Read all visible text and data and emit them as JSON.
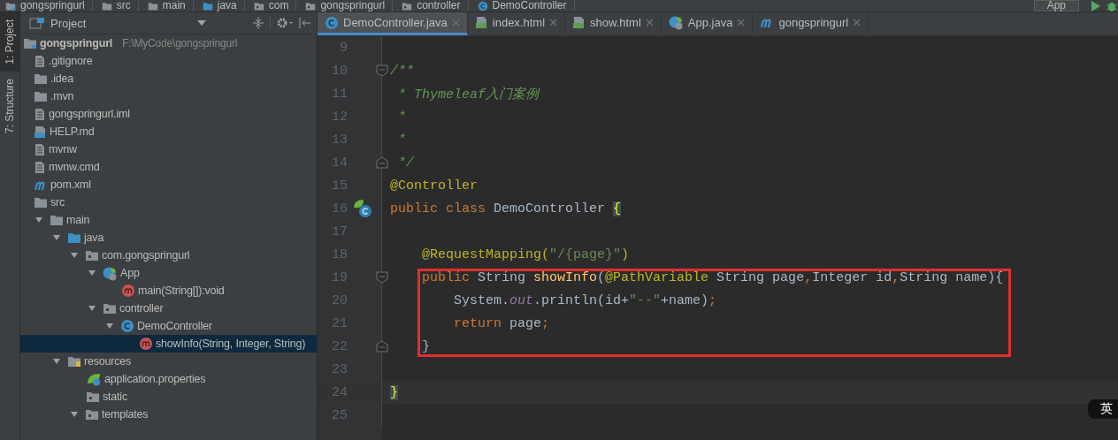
{
  "breadcrumbs": [
    {
      "label": "gongspringurl",
      "kind": "module"
    },
    {
      "label": "src",
      "kind": "folder"
    },
    {
      "label": "main",
      "kind": "folder"
    },
    {
      "label": "java",
      "kind": "java-folder"
    },
    {
      "label": "com",
      "kind": "package"
    },
    {
      "label": "gongspringurl",
      "kind": "package"
    },
    {
      "label": "controller",
      "kind": "package"
    },
    {
      "label": "DemoController",
      "kind": "class"
    }
  ],
  "run_config": {
    "label": "App"
  },
  "tool_strip": [
    {
      "label": "1: Project",
      "selected": true
    },
    {
      "label": "7: Structure",
      "selected": false
    }
  ],
  "project_panel": {
    "title": "Project",
    "tree": [
      {
        "label": "gongspringurl",
        "path": "F:\\MyCode\\gongspringurl",
        "kind": "module",
        "selected": false,
        "children": [
          {
            "label": ".gitignore",
            "kind": "text-file",
            "selected": false
          },
          {
            "label": ".idea",
            "kind": "folder",
            "selected": false
          },
          {
            "label": ".mvn",
            "kind": "folder",
            "selected": false
          },
          {
            "label": "gongspringurl.iml",
            "kind": "iml",
            "selected": false
          },
          {
            "label": "HELP.md",
            "kind": "md",
            "selected": false
          },
          {
            "label": "mvnw",
            "kind": "text-file",
            "selected": false
          },
          {
            "label": "mvnw.cmd",
            "kind": "text-file",
            "selected": false
          },
          {
            "label": "pom.xml",
            "kind": "maven",
            "selected": false
          },
          {
            "label": "src",
            "kind": "folder",
            "selected": false,
            "children": [
              {
                "label": "main",
                "kind": "folder",
                "selected": false,
                "expanded": true,
                "children": [
                  {
                    "label": "java",
                    "kind": "java-folder",
                    "selected": false,
                    "expanded": true,
                    "children": [
                      {
                        "label": "com.gongspringurl",
                        "kind": "package",
                        "selected": false,
                        "expanded": true,
                        "children": [
                          {
                            "label": "App",
                            "kind": "spring-class",
                            "selected": false,
                            "expanded": true,
                            "children": [
                              {
                                "label": "main(String[]):void",
                                "kind": "method",
                                "selected": false
                              }
                            ]
                          },
                          {
                            "label": "controller",
                            "kind": "package",
                            "selected": false,
                            "expanded": true,
                            "children": [
                              {
                                "label": "DemoController",
                                "kind": "class",
                                "selected": false,
                                "expanded": true,
                                "children": [
                                  {
                                    "label": "showInfo(String, Integer, String)",
                                    "kind": "method",
                                    "selected": true
                                  }
                                ]
                              }
                            ]
                          }
                        ]
                      }
                    ]
                  },
                  {
                    "label": "resources",
                    "kind": "resources-folder",
                    "selected": false,
                    "expanded": true,
                    "children": [
                      {
                        "label": "application.properties",
                        "kind": "spring-props",
                        "selected": false
                      },
                      {
                        "label": "static",
                        "kind": "package",
                        "selected": false
                      },
                      {
                        "label": "templates",
                        "kind": "package",
                        "selected": false,
                        "expanded": true
                      }
                    ]
                  }
                ]
              }
            ]
          }
        ]
      }
    ]
  },
  "tabs": [
    {
      "label": "DemoController.java",
      "kind": "class",
      "selected": true
    },
    {
      "label": "index.html",
      "kind": "html",
      "selected": false
    },
    {
      "label": "show.html",
      "kind": "html",
      "selected": false
    },
    {
      "label": "App.java",
      "kind": "spring-class",
      "selected": false
    },
    {
      "label": "gongspringurl",
      "kind": "maven",
      "selected": false
    }
  ],
  "editor": {
    "lines": [
      {
        "number": "9",
        "kind": "plain",
        "current": false,
        "boxed": false
      },
      {
        "number": "10",
        "kind": "fold-start",
        "current": false,
        "boxed": false,
        "tokens": [
          {
            "kind": "comment",
            "text": "/**"
          }
        ]
      },
      {
        "number": "11",
        "kind": "plain",
        "current": false,
        "boxed": false,
        "tokens": [
          {
            "kind": "comment",
            "text": " * Thymeleaf入门案例"
          }
        ]
      },
      {
        "number": "12",
        "kind": "plain",
        "current": false,
        "boxed": false,
        "tokens": [
          {
            "kind": "comment",
            "text": " *"
          }
        ]
      },
      {
        "number": "13",
        "kind": "plain",
        "current": false,
        "boxed": false,
        "tokens": [
          {
            "kind": "comment",
            "text": " *"
          }
        ]
      },
      {
        "number": "14",
        "kind": "fold-end",
        "current": false,
        "boxed": false,
        "tokens": [
          {
            "kind": "comment",
            "text": " */"
          }
        ]
      },
      {
        "number": "15",
        "kind": "plain",
        "current": false,
        "boxed": false,
        "tokens": [
          {
            "kind": "annotation",
            "text": "@Controller"
          }
        ]
      },
      {
        "number": "16",
        "kind": "class-marker",
        "current": false,
        "boxed": false,
        "tokens": [
          {
            "kind": "keyword",
            "text": "public class "
          },
          {
            "kind": "plain",
            "text": "DemoController "
          },
          {
            "kind": "brace",
            "text": "{"
          }
        ]
      },
      {
        "number": "17",
        "kind": "plain",
        "current": false,
        "boxed": false
      },
      {
        "number": "18",
        "kind": "plain",
        "current": false,
        "boxed": false,
        "tokens": [
          {
            "kind": "annotation",
            "text": "    @RequestMapping("
          },
          {
            "kind": "string",
            "text": "\"/{page}\""
          },
          {
            "kind": "annotation",
            "text": ")"
          }
        ]
      },
      {
        "number": "19",
        "kind": "fold-start",
        "current": false,
        "boxed": true,
        "tokens": [
          {
            "kind": "keyword",
            "text": "    public "
          },
          {
            "kind": "plain",
            "text": "String "
          },
          {
            "kind": "method",
            "text": "showInfo"
          },
          {
            "kind": "plain",
            "text": "("
          },
          {
            "kind": "annotation",
            "text": "@PathVariable"
          },
          {
            "kind": "plain",
            "text": " String page"
          },
          {
            "kind": "keyword",
            "text": ","
          },
          {
            "kind": "plain",
            "text": "Integer id"
          },
          {
            "kind": "keyword",
            "text": ","
          },
          {
            "kind": "plain",
            "text": "String name){"
          }
        ]
      },
      {
        "number": "20",
        "kind": "plain",
        "current": false,
        "boxed": true,
        "tokens": [
          {
            "kind": "plain",
            "text": "        System."
          },
          {
            "kind": "field",
            "text": "out"
          },
          {
            "kind": "plain",
            "text": ".println(id+"
          },
          {
            "kind": "string",
            "text": "\"--\""
          },
          {
            "kind": "plain",
            "text": "+name)"
          },
          {
            "kind": "keyword",
            "text": ";"
          }
        ]
      },
      {
        "number": "21",
        "kind": "plain",
        "current": false,
        "boxed": true,
        "tokens": [
          {
            "kind": "keyword",
            "text": "        return "
          },
          {
            "kind": "plain",
            "text": "page"
          },
          {
            "kind": "keyword",
            "text": ";"
          }
        ]
      },
      {
        "number": "22",
        "kind": "fold-end",
        "current": false,
        "boxed": true,
        "tokens": [
          {
            "kind": "plain",
            "text": "    }"
          }
        ]
      },
      {
        "number": "23",
        "kind": "plain",
        "current": false,
        "boxed": false
      },
      {
        "number": "24",
        "kind": "plain",
        "current": true,
        "boxed": false,
        "tokens": [
          {
            "kind": "brace",
            "text": "}"
          }
        ]
      },
      {
        "number": "25",
        "kind": "plain",
        "current": false,
        "boxed": false
      }
    ]
  },
  "ime_indicator": {
    "label": "英"
  }
}
